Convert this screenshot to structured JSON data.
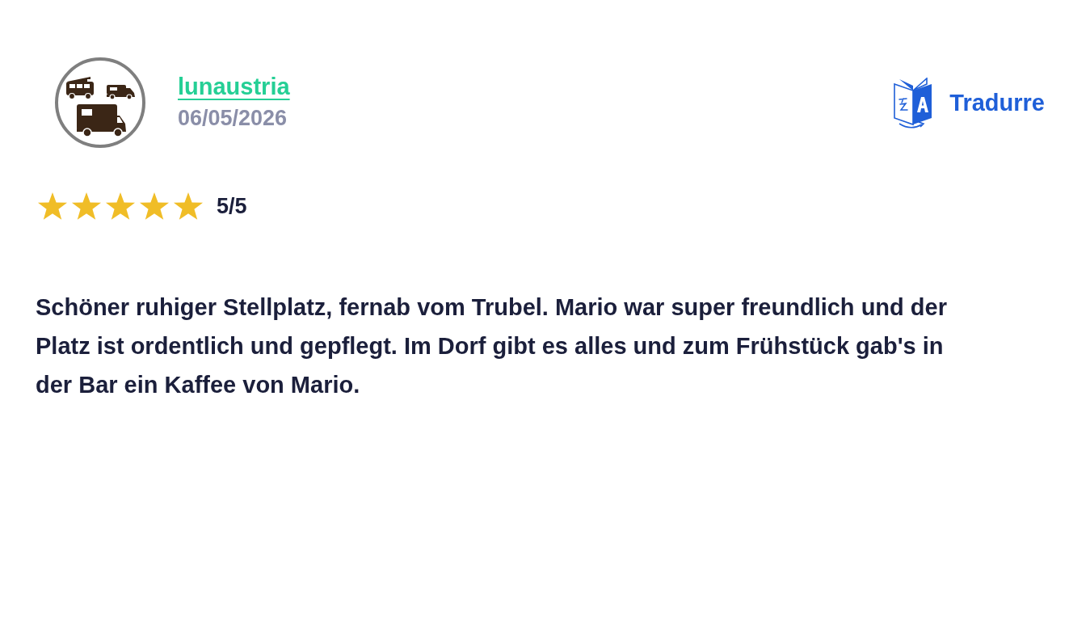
{
  "review": {
    "author": {
      "name": "lunaustria",
      "date": "06/05/2026"
    },
    "translate_button": {
      "label": "Tradurre"
    },
    "rating": {
      "stars": 5,
      "text": "5/5"
    },
    "text": "Schöner ruhiger Stellplatz, fernab vom Trubel. Mario war super freundlich und der Platz ist ordentlich und gepflegt. Im Dorf gibt es alles und zum Frühstück gab's in der Bar ein Kaffee von Mario."
  }
}
